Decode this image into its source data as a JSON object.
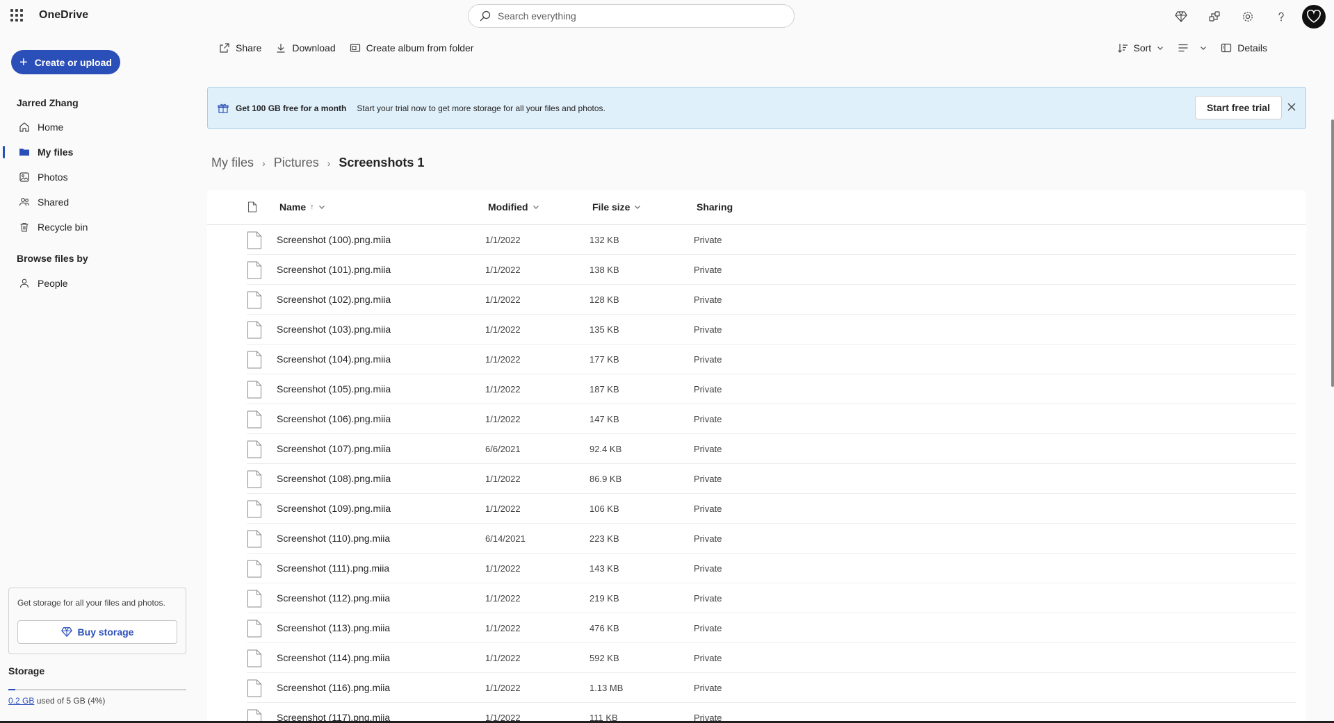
{
  "app": {
    "name": "OneDrive"
  },
  "search": {
    "placeholder": "Search everything"
  },
  "sidebar": {
    "create_label": "Create or upload",
    "user_name": "Jarred Zhang",
    "nav": [
      {
        "label": "Home",
        "icon": "home-icon"
      },
      {
        "label": "My files",
        "icon": "folder-icon",
        "active": true
      },
      {
        "label": "Photos",
        "icon": "photo-icon"
      },
      {
        "label": "Shared",
        "icon": "people-icon"
      },
      {
        "label": "Recycle bin",
        "icon": "trash-icon"
      }
    ],
    "browse_label": "Browse files by",
    "browse": [
      {
        "label": "People",
        "icon": "person-icon"
      }
    ],
    "promo_text": "Get storage for all your files and photos.",
    "buy_label": "Buy storage",
    "storage_label": "Storage",
    "storage_used": "0.2 GB",
    "storage_total_text": "used of 5 GB (4%)",
    "storage_fraction": 0.04
  },
  "toolbar": {
    "share": "Share",
    "download": "Download",
    "create_album": "Create album from folder",
    "sort": "Sort",
    "details": "Details"
  },
  "banner": {
    "title": "Get 100 GB free for a month",
    "text": "Start your trial now to get more storage for all your files and photos.",
    "button": "Start free trial"
  },
  "breadcrumb": [
    "My files",
    "Pictures",
    "Screenshots 1"
  ],
  "table": {
    "headers": {
      "name": "Name",
      "sort_arrow": "↑",
      "modified": "Modified",
      "size": "File size",
      "sharing": "Sharing"
    },
    "rows": [
      {
        "name": "Screenshot (100).png.miia",
        "modified": "1/1/2022",
        "size": "132 KB",
        "sharing": "Private"
      },
      {
        "name": "Screenshot (101).png.miia",
        "modified": "1/1/2022",
        "size": "138 KB",
        "sharing": "Private"
      },
      {
        "name": "Screenshot (102).png.miia",
        "modified": "1/1/2022",
        "size": "128 KB",
        "sharing": "Private"
      },
      {
        "name": "Screenshot (103).png.miia",
        "modified": "1/1/2022",
        "size": "135 KB",
        "sharing": "Private"
      },
      {
        "name": "Screenshot (104).png.miia",
        "modified": "1/1/2022",
        "size": "177 KB",
        "sharing": "Private"
      },
      {
        "name": "Screenshot (105).png.miia",
        "modified": "1/1/2022",
        "size": "187 KB",
        "sharing": "Private"
      },
      {
        "name": "Screenshot (106).png.miia",
        "modified": "1/1/2022",
        "size": "147 KB",
        "sharing": "Private"
      },
      {
        "name": "Screenshot (107).png.miia",
        "modified": "6/6/2021",
        "size": "92.4 KB",
        "sharing": "Private"
      },
      {
        "name": "Screenshot (108).png.miia",
        "modified": "1/1/2022",
        "size": "86.9 KB",
        "sharing": "Private"
      },
      {
        "name": "Screenshot (109).png.miia",
        "modified": "1/1/2022",
        "size": "106 KB",
        "sharing": "Private"
      },
      {
        "name": "Screenshot (110).png.miia",
        "modified": "6/14/2021",
        "size": "223 KB",
        "sharing": "Private"
      },
      {
        "name": "Screenshot (111).png.miia",
        "modified": "1/1/2022",
        "size": "143 KB",
        "sharing": "Private"
      },
      {
        "name": "Screenshot (112).png.miia",
        "modified": "1/1/2022",
        "size": "219 KB",
        "sharing": "Private"
      },
      {
        "name": "Screenshot (113).png.miia",
        "modified": "1/1/2022",
        "size": "476 KB",
        "sharing": "Private"
      },
      {
        "name": "Screenshot (114).png.miia",
        "modified": "1/1/2022",
        "size": "592 KB",
        "sharing": "Private"
      },
      {
        "name": "Screenshot (116).png.miia",
        "modified": "1/1/2022",
        "size": "1.13 MB",
        "sharing": "Private"
      },
      {
        "name": "Screenshot (117).png.miia",
        "modified": "1/1/2022",
        "size": "111 KB",
        "sharing": "Private"
      }
    ]
  }
}
